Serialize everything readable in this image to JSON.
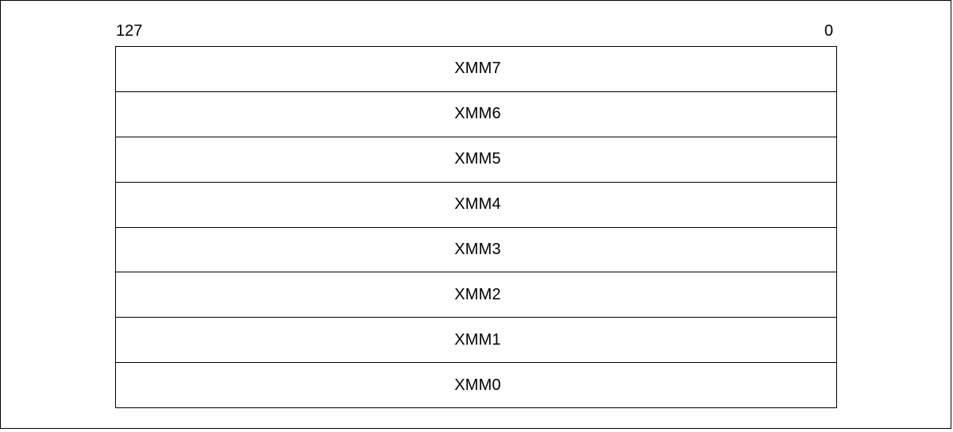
{
  "bit_labels": {
    "high": "127",
    "low": "0"
  },
  "registers": [
    "XMM7",
    "XMM6",
    "XMM5",
    "XMM4",
    "XMM3",
    "XMM2",
    "XMM1",
    "XMM0"
  ]
}
